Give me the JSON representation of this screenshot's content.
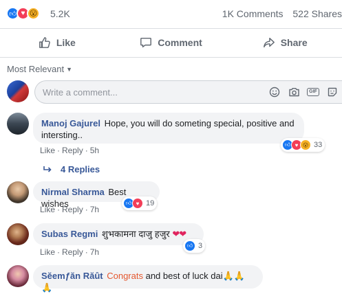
{
  "post": {
    "reaction_count": "5.2K",
    "reaction_icons": [
      "like",
      "love",
      "wow"
    ],
    "comments_count": "1K Comments",
    "shares_count": "522 Shares"
  },
  "actions": {
    "like": "Like",
    "comment": "Comment",
    "share": "Share"
  },
  "sort_label": "Most Relevant",
  "composer": {
    "placeholder": "Write a comment...",
    "icons": [
      "emoji-icon",
      "camera-icon",
      "gif-icon",
      "sticker-icon"
    ],
    "gif_label": "GIF"
  },
  "comments": [
    {
      "author": "Manoj Gajurel",
      "text_line1": "Hope, you will do someting special, positive and",
      "text_line2": "intersting..",
      "like": "Like",
      "reply": "Reply",
      "time": "5h",
      "reaction_icons": [
        "like",
        "love",
        "wow"
      ],
      "reaction_count": "33",
      "replies": "4 Replies"
    },
    {
      "author": "Nirmal Sharma",
      "text": "Best wishes",
      "like": "Like",
      "reply": "Reply",
      "time": "7h",
      "reaction_icons": [
        "like",
        "love"
      ],
      "reaction_count": "19"
    },
    {
      "author": "Subas Regmi",
      "text": "शुभकामना दाजु हजुर",
      "emoji": "❤❤",
      "like": "Like",
      "reply": "Reply",
      "time": "7h",
      "reaction_icons": [
        "like"
      ],
      "reaction_count": "3"
    },
    {
      "author": "Sĕemƒăn Răût",
      "tag": "Congrats",
      "text": "and best of luck dai",
      "emoji": "🙏🙏🙏"
    }
  ],
  "colors": {
    "link": "#385898",
    "tag": "#e4572e",
    "bubble": "#f2f3f5",
    "like": "#1877f2",
    "love": "#f33e58",
    "wow": "#f7b125",
    "meta": "#606770"
  }
}
